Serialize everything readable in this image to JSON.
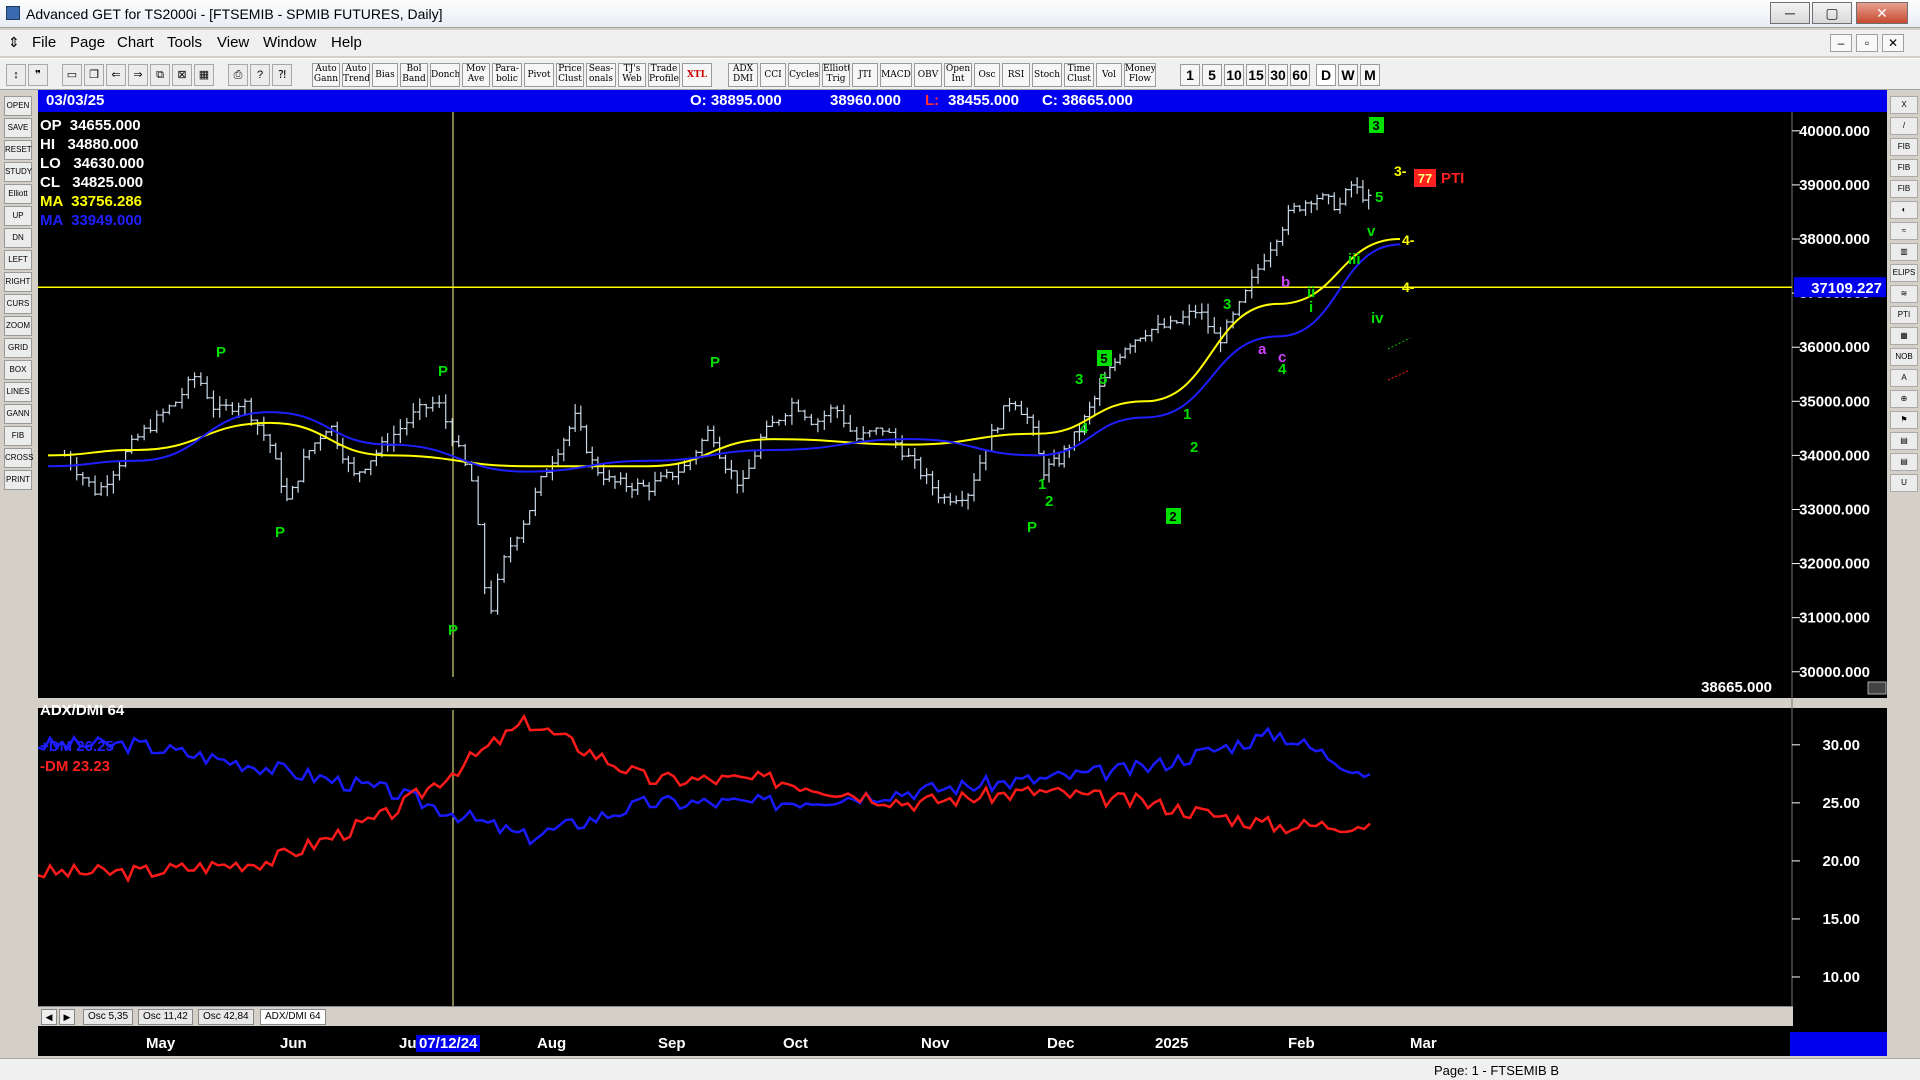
{
  "window": {
    "title": "Advanced GET for TS2000i - [FTSEMIB - SPMIB FUTURES, Daily]",
    "min_label": "─",
    "max_label": "▢",
    "close_label": "✕"
  },
  "menu": {
    "items": [
      "File",
      "Page",
      "Chart",
      "Tools",
      "View",
      "Window",
      "Help"
    ],
    "mdi_buttons": [
      "‒",
      "▫",
      "✕"
    ]
  },
  "toolbar": {
    "studies": [
      "Auto Gann",
      "Auto Trend",
      "Bias",
      "Bol Band",
      "Donch",
      "Mov Ave",
      "Para-bolic",
      "Pivot",
      "Price Clust",
      "Seas-onals",
      "TJ's Web",
      "Trade Profile",
      "XTL",
      "ADX DMI",
      "CCI",
      "Cycles",
      "Elliott Trig",
      "JTI",
      "MACD",
      "OBV",
      "Open Int",
      "Osc",
      "RSI",
      "Stoch",
      "Time Clust",
      "Vol",
      "Money Flow"
    ],
    "intervals": [
      "1",
      "5",
      "10",
      "15",
      "30",
      "60",
      "D",
      "W",
      "M"
    ],
    "selected_interval": "D"
  },
  "left_tools": [
    "OPEN",
    "SAVE",
    "RESET",
    "STUDY",
    "Elliott",
    "UP",
    "DN",
    "LEFT",
    "RIGHT",
    "CURS",
    "ZOOM",
    "GRID",
    "BOX",
    "LINES",
    "GANN",
    "FIB",
    "CROSS",
    "PRINT"
  ],
  "right_tools": [
    "X",
    "/",
    "FIB RET",
    "FIB EXT",
    "FIB TIME",
    "◐",
    "≈",
    "▥",
    "ELIPS",
    "≋",
    "PTI",
    "▦",
    "NOB",
    "A",
    "⊕",
    "⚑",
    "▤",
    "▤",
    "U"
  ],
  "header": {
    "date": "03/03/25",
    "open": "O: 38895.000",
    "high": "38960.000",
    "low_prefix": "L:",
    "low": "38455.000",
    "close": "C: 38665.000"
  },
  "info": {
    "op": "OP  34655.000",
    "hi": "HI   34880.000",
    "lo": "LO   34630.000",
    "cl": "CL   34825.000",
    "ma1": "MA  33756.286",
    "ma2": "MA  33949.000"
  },
  "price_axis": {
    "ticks": [
      "40000.000",
      "39000.000",
      "38000.000",
      "37000.000",
      "36000.000",
      "35000.000",
      "34000.000",
      "33000.000",
      "32000.000",
      "31000.000",
      "30000.000"
    ],
    "horizontal_line_label": "37109.227",
    "last_price": "38665.000"
  },
  "elliott_labels": {
    "pti_value": "77",
    "pti_text": "PTI",
    "wave_3_box": "3",
    "wave_5_box": "5",
    "wave_2_box": "2",
    "target_4_a": "4-",
    "target_4_b": "4-",
    "target_3": "3-"
  },
  "indicator": {
    "title": "ADX/DMI 64",
    "dm_plus": "+DM 26.25",
    "dm_minus": "-DM  23.23",
    "ticks": [
      "30.00",
      "25.00",
      "20.00",
      "15.00",
      "10.00"
    ]
  },
  "tabs": [
    "Osc 5,35",
    "Osc 11,42",
    "Osc 42,84",
    "ADX/DMI 64"
  ],
  "tab_arrows": [
    "◀",
    "▶"
  ],
  "date_axis": {
    "months": [
      "May",
      "Jun",
      "Jul",
      "Aug",
      "Sep",
      "Oct",
      "Nov",
      "Dec",
      "2025",
      "Feb",
      "Mar"
    ],
    "cursor_date": "07/12/24"
  },
  "status": {
    "text": "Page: 1 - FTSEMIB B"
  },
  "colors": {
    "ma_yellow": "#ffff00",
    "ma_blue": "#1e1eff",
    "dm_plus": "#1a1aff",
    "dm_minus": "#ff1a1a",
    "wave_green": "#00e000",
    "header_blue": "#0000ee"
  },
  "chart_data": {
    "type": "line",
    "price_series": [
      {
        "name": "MA 33756.286",
        "x": [
          "May",
          "Jun",
          "Jul",
          "Aug",
          "Sep",
          "Oct",
          "Nov",
          "Dec",
          "2025",
          "Feb",
          "Mar"
        ],
        "values": [
          34100,
          34600,
          34000,
          33800,
          33800,
          34300,
          34200,
          34400,
          35000,
          36800,
          38000
        ]
      },
      {
        "name": "MA 33949.000",
        "x": [
          "May",
          "Jun",
          "Jul",
          "Aug",
          "Sep",
          "Oct",
          "Nov",
          "Dec",
          "2025",
          "Feb",
          "Mar"
        ],
        "values": [
          33900,
          34800,
          34200,
          33700,
          33900,
          34100,
          34300,
          34000,
          34700,
          36200,
          37900
        ]
      }
    ],
    "indicator_series": [
      {
        "name": "+DM 26.25",
        "x": [
          "May",
          "Jun",
          "Jul",
          "Aug",
          "Sep",
          "Oct",
          "Nov",
          "Dec",
          "2025",
          "Feb",
          "Mar"
        ],
        "values": [
          30,
          28,
          26,
          22,
          25,
          25,
          26,
          27,
          28,
          31,
          26.25
        ]
      },
      {
        "name": "-DM  23.23",
        "x": [
          "May",
          "Jun",
          "Jul",
          "Aug",
          "Sep",
          "Oct",
          "Nov",
          "Dec",
          "2025",
          "Feb",
          "Mar"
        ],
        "values": [
          19,
          20,
          24,
          32,
          27,
          27,
          25,
          26,
          25,
          23,
          23.23
        ]
      }
    ],
    "ylim_price": [
      29700,
      40200
    ],
    "ylim_indicator": [
      7.5,
      33
    ]
  }
}
